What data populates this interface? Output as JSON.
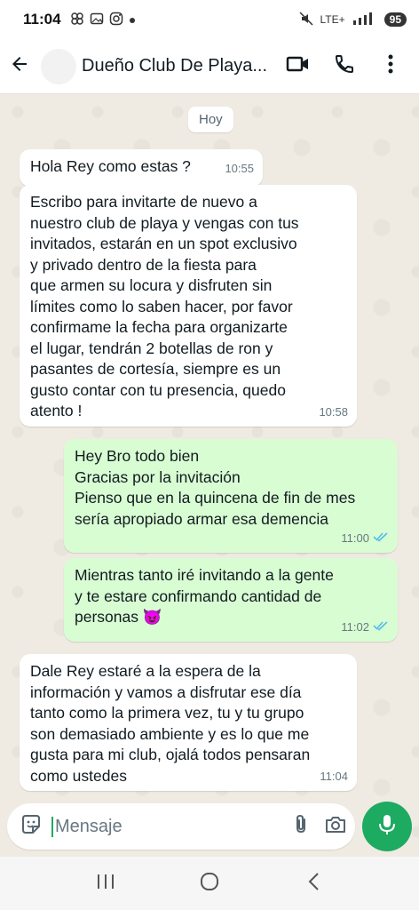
{
  "status_bar": {
    "time": "11:04",
    "battery": "95",
    "network": "LTE+",
    "icons": [
      "pinwheel-icon",
      "gallery-icon",
      "instagram-icon",
      "dot-icon",
      "mute-icon",
      "signal-icon",
      "battery-icon"
    ]
  },
  "header": {
    "contact_name": "Dueño Club De Playa...",
    "icons": [
      "back-arrow-icon",
      "video-call-icon",
      "phone-icon",
      "more-vert-icon"
    ]
  },
  "chat": {
    "date_chip": "Hoy",
    "messages": [
      {
        "direction": "in",
        "text": "Hola Rey como estas ?",
        "time": "10:55"
      },
      {
        "direction": "in",
        "text": "Escribo para invitarte de nuevo a\nnuestro club de playa y vengas con tus\ninvitados, estarán en un spot exclusivo\ny privado dentro de la fiesta para\nque armen su locura y disfruten sin\nlímites como lo saben hacer, por favor\nconfirmame la fecha para organizarte\nel lugar, tendrán 2 botellas de ron y\npasantes de cortesía, siempre es un\ngusto contar con tu presencia,  quedo\natento !",
        "time": "10:58"
      },
      {
        "direction": "out",
        "text": "Hey Bro todo bien\nGracias por la invitación\nPienso que en la quincena de fin de mes\nsería apropiado armar esa demencia",
        "time": "11:00",
        "status": "read"
      },
      {
        "direction": "out",
        "text": "Mientras tanto iré invitando a la gente\ny te estare confirmando cantidad de\npersonas 😈",
        "time": "11:02",
        "status": "read"
      },
      {
        "direction": "in",
        "text": "Dale Rey estaré a la espera de la\ninformación y vamos a disfrutar ese día\ntanto como la primera vez, tu y tu grupo\nson demasiado ambiente y es lo que me\ngusta para mi club, ojalá todos pensaran\ncomo ustedes",
        "time": "11:04"
      }
    ]
  },
  "composer": {
    "placeholder": "Mensaje",
    "value": ""
  },
  "colors": {
    "accent": "#1daa61",
    "outgoing_bubble": "#d9fdd3",
    "incoming_bubble": "#ffffff",
    "chat_background": "#efeae2",
    "read_ticks": "#53bdeb"
  }
}
